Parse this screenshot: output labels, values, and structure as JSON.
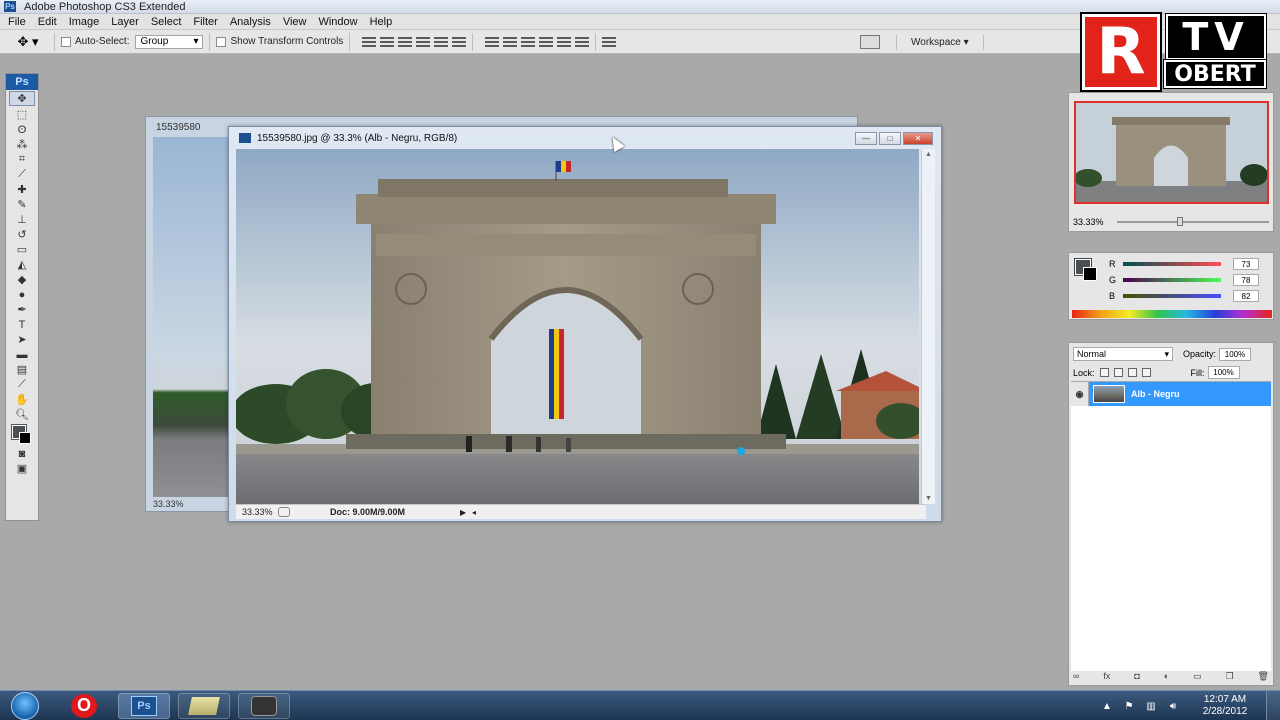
{
  "app": {
    "title": "Adobe Photoshop CS3 Extended",
    "icon": "photoshop-icon"
  },
  "menu": [
    "File",
    "Edit",
    "Image",
    "Layer",
    "Select",
    "Filter",
    "Analysis",
    "View",
    "Window",
    "Help"
  ],
  "options": {
    "auto_select_label": "Auto-Select:",
    "auto_select_value": "Group",
    "show_transform_label": "Show Transform Controls",
    "workspace_label": "Workspace"
  },
  "tools": {
    "panel_label": "Ps"
  },
  "back_document": {
    "title": "15539580",
    "zoom": "33.33%"
  },
  "document": {
    "title": "15539580.jpg @ 33.3% (Alb - Negru, RGB/8)",
    "zoom": "33.33%",
    "doc_info": "Doc: 9.00M/9.00M"
  },
  "logo": {
    "r": "R",
    "tv": "TV",
    "name": "OBERT"
  },
  "navigator": {
    "zoom": "33.33%"
  },
  "color": {
    "r_label": "R",
    "r_value": "73",
    "g_label": "G",
    "g_value": "78",
    "b_label": "B",
    "b_value": "82",
    "fg_color": "#494e52",
    "bg_color": "#000000"
  },
  "layers": {
    "blend_mode": "Normal",
    "opacity_label": "Opacity:",
    "opacity_value": "100%",
    "lock_label": "Lock:",
    "fill_label": "Fill:",
    "fill_value": "100%",
    "layer_name": "Alb - Negru"
  },
  "taskbar": {
    "time": "12:07 AM",
    "date": "2/28/2012",
    "ps_label": "Ps"
  }
}
